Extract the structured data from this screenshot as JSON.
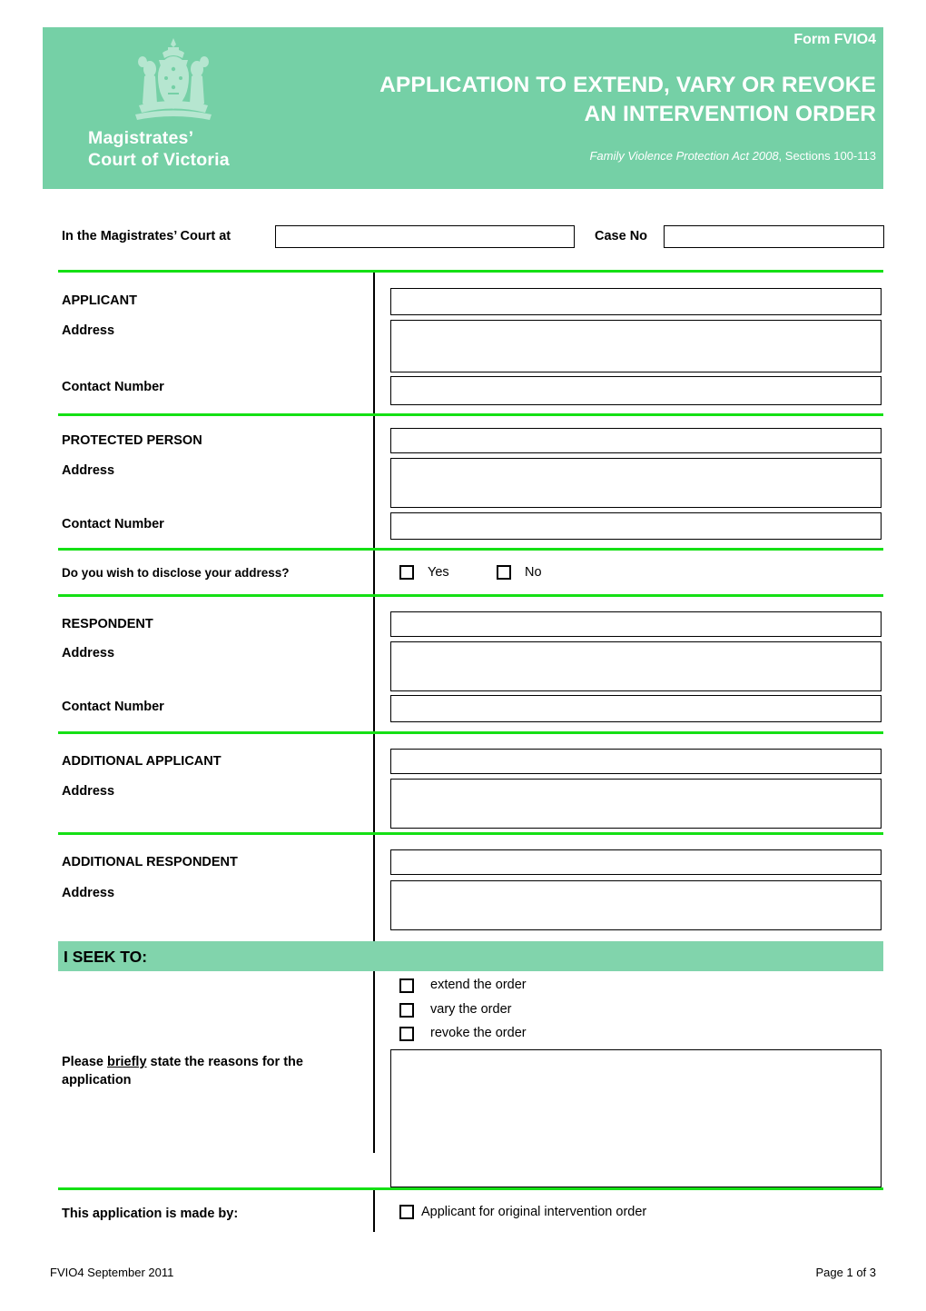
{
  "header": {
    "form_code": "Form FVIO4",
    "title_line1": "APPLICATION TO EXTEND, VARY OR REVOKE",
    "title_line2": "AN INTERVENTION ORDER",
    "act_italic": "Family Violence Protection Act 2008",
    "act_rest": ", Sections 100-113",
    "court_name_line1": "Magistrates’",
    "court_name_line2": "Court of Victoria",
    "band_color": "#75d0a6"
  },
  "court_row": {
    "court_label": "In the Magistrates’ Court at",
    "court_value": "",
    "caseno_label": "Case No",
    "caseno_value": ""
  },
  "sections": {
    "applicant": {
      "title": "APPLICANT",
      "address_label": "Address",
      "contact_label": "Contact Number",
      "name_value": "",
      "address_value": "",
      "contact_value": ""
    },
    "protected_person": {
      "title": "PROTECTED PERSON",
      "address_label": "Address",
      "contact_label": "Contact Number",
      "name_value": "",
      "address_value": "",
      "contact_value": ""
    },
    "disclose": {
      "question": "Do you wish to disclose your address?",
      "yes_label": "Yes",
      "no_label": "No"
    },
    "respondent": {
      "title": "RESPONDENT",
      "address_label": "Address",
      "contact_label": "Contact Number",
      "name_value": "",
      "address_value": "",
      "contact_value": ""
    },
    "additional_applicant": {
      "title": "ADDITIONAL APPLICANT",
      "address_label": "Address",
      "name_value": "",
      "address_value": ""
    },
    "additional_respondent": {
      "title": "ADDITIONAL RESPONDENT",
      "address_label": "Address",
      "name_value": "",
      "address_value": ""
    }
  },
  "seek": {
    "band_title": "I SEEK TO:",
    "band_color": "#81d4ac",
    "options": [
      {
        "label": "extend the order"
      },
      {
        "label": "vary the order"
      },
      {
        "label": "revoke the order"
      }
    ],
    "reasons_label_part1": "Please ",
    "reasons_label_underlined": "briefly",
    "reasons_label_part2": " state the reasons for the application",
    "reasons_value": ""
  },
  "made_by": {
    "label": "This application is made by:",
    "option_label": "Applicant for original intervention order"
  },
  "footer": {
    "left": "FVIO4 September 2011",
    "right": "Page 1 of 3"
  },
  "theme": {
    "divider_green": "#15e015",
    "header_green": "#75d0a6",
    "seek_green": "#81d4ac"
  }
}
